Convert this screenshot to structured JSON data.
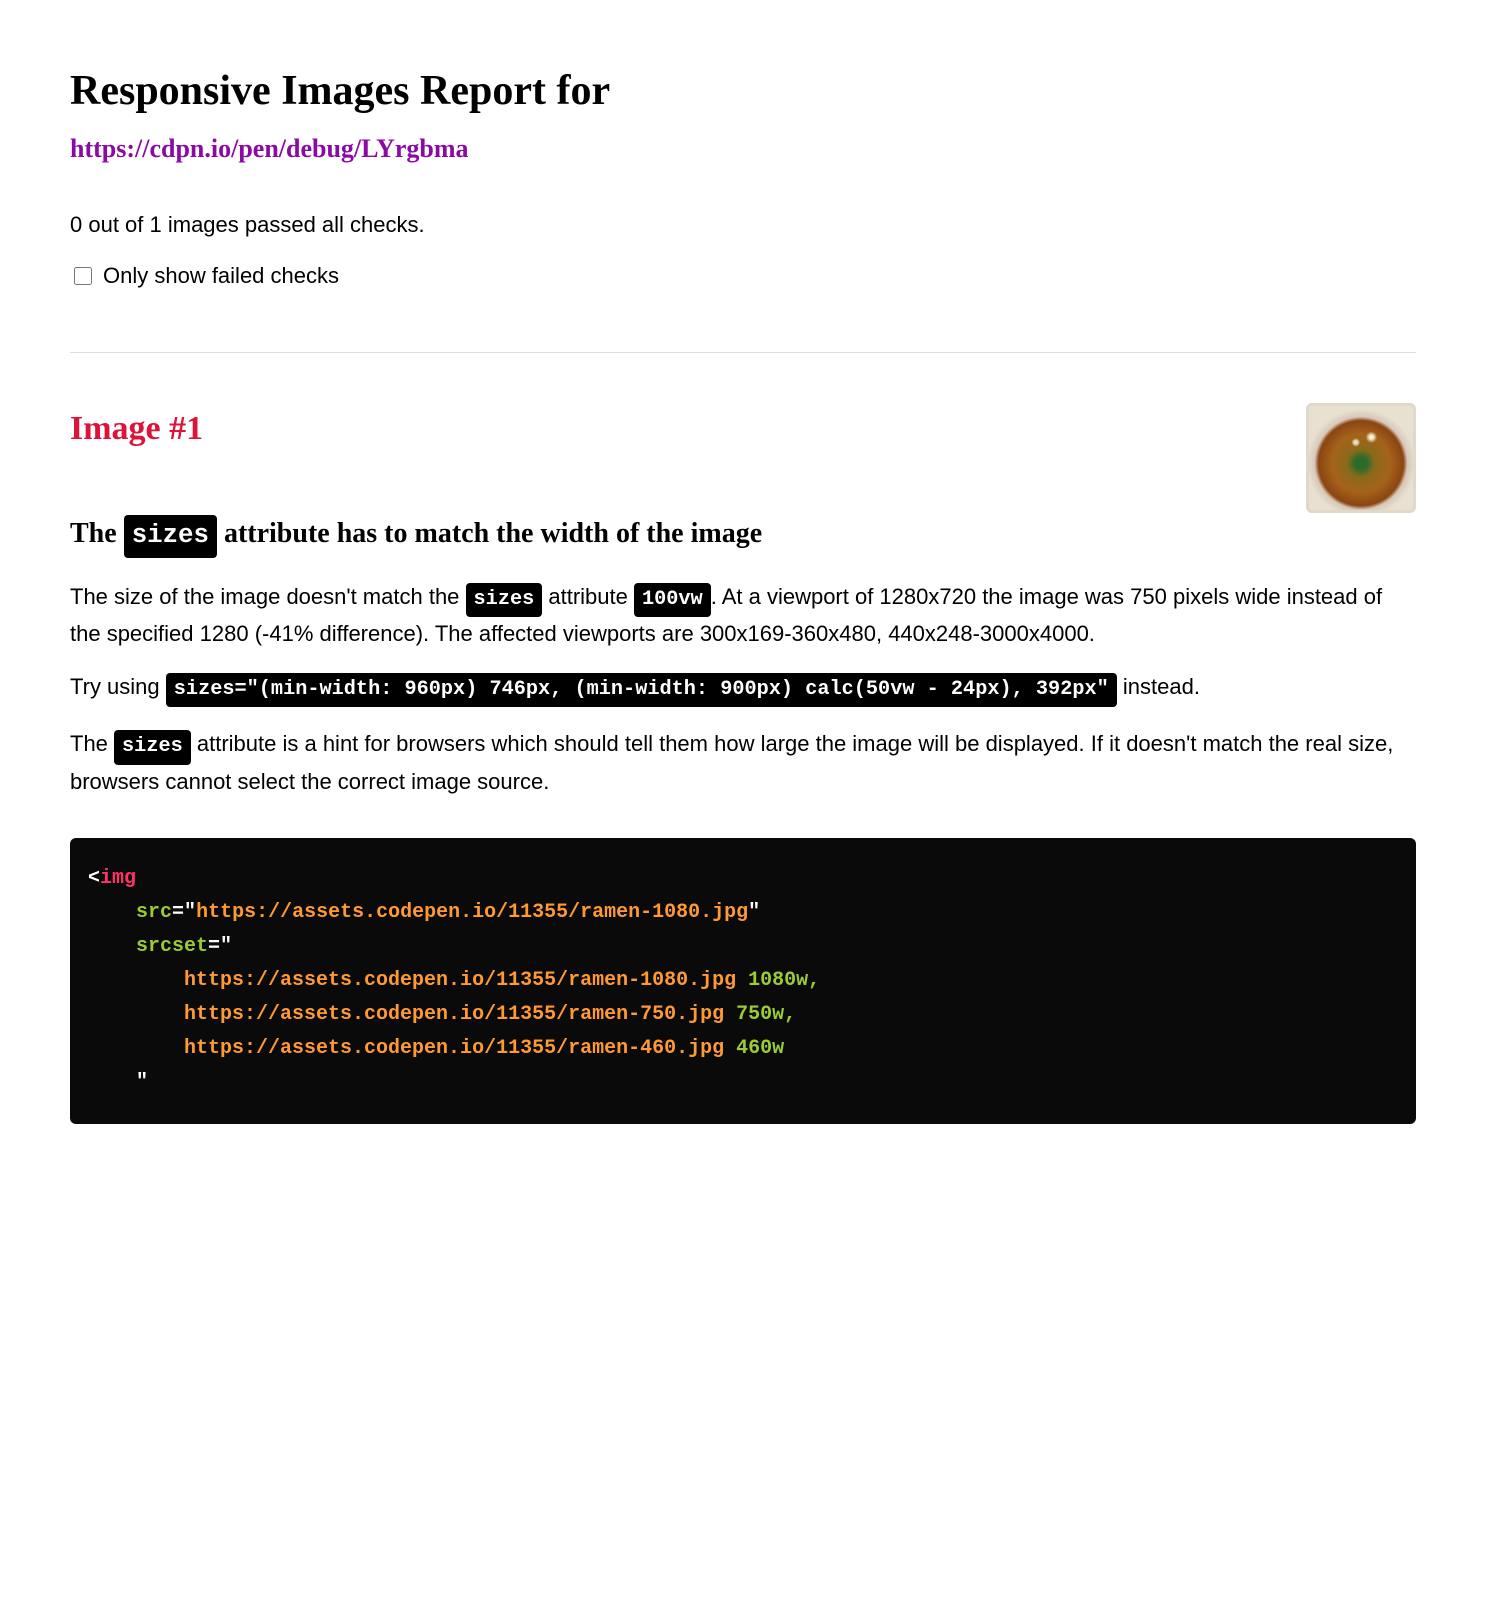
{
  "header": {
    "title": "Responsive Images Report for",
    "url": "https://cdpn.io/pen/debug/LYrgbma"
  },
  "summary": {
    "text": "0 out of 1 images passed all checks.",
    "filter_label": "Only show failed checks"
  },
  "image1": {
    "heading": "Image #1",
    "check_title_pre": "The ",
    "check_title_code": "sizes",
    "check_title_post": " attribute has to match the width of the image",
    "p1_a": "The size of the image doesn't match the ",
    "p1_code1": "sizes",
    "p1_b": " attribute ",
    "p1_code2": "100vw",
    "p1_c": ". At a viewport of 1280x720 the image was 750 pixels wide instead of the specified 1280 (-41% difference). The affected viewports are 300x169-360x480, 440x248-3000x4000.",
    "p2_a": "Try using ",
    "p2_code": "sizes=\"(min-width: 960px) 746px, (min-width: 900px) calc(50vw - 24px), 392px\"",
    "p2_b": " instead.",
    "p3_a": "The ",
    "p3_code": "sizes",
    "p3_b": " attribute is a hint for browsers which should tell them how large the image will be displayed. If it doesn't match the real size, browsers cannot select the correct image source."
  },
  "code": {
    "tag": "img",
    "attr_src": "src",
    "val_src": "https://assets.codepen.io/11355/ramen-1080.jpg",
    "attr_srcset": "srcset",
    "srcset_line1_url": "https://assets.codepen.io/11355/ramen-1080.jpg",
    "srcset_line1_w": " 1080w,",
    "srcset_line2_url": "https://assets.codepen.io/11355/ramen-750.jpg",
    "srcset_line2_w": " 750w,",
    "srcset_line3_url": "https://assets.codepen.io/11355/ramen-460.jpg",
    "srcset_line3_w": " 460w"
  }
}
